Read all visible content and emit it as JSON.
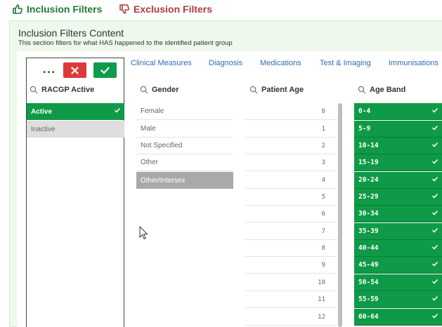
{
  "top_tabs": {
    "inclusion": "Inclusion Filters",
    "exclusion": "Exclusion Filters"
  },
  "content": {
    "title": "Inclusion Filters Content",
    "subtitle": "This section filters for what HAS happened to the identified patient group"
  },
  "nav_tabs": [
    "Clinical Measures",
    "Diagnosis",
    "Medications",
    "Test & Imaging",
    "Immunisations"
  ],
  "selection_toolbar": {
    "more": "...",
    "cancel_icon": "close-icon",
    "confirm_icon": "check-icon"
  },
  "columns": {
    "racgp": {
      "header": "RACGP Active",
      "items": [
        {
          "label": "Active",
          "state": "selected"
        },
        {
          "label": "Inactive",
          "state": "alternative"
        }
      ]
    },
    "gender": {
      "header": "Gender",
      "items": [
        {
          "label": "Female",
          "state": "possible"
        },
        {
          "label": "Male",
          "state": "possible"
        },
        {
          "label": "Not Specified",
          "state": "possible"
        },
        {
          "label": "Other",
          "state": "possible"
        },
        {
          "label": "Other/Intersex",
          "state": "excluded"
        }
      ]
    },
    "patient_age": {
      "header": "Patient Age",
      "items": [
        "0",
        "1",
        "2",
        "3",
        "4",
        "5",
        "6",
        "7",
        "8",
        "9",
        "10",
        "11",
        "12"
      ]
    },
    "age_band": {
      "header": "Age Band",
      "items": [
        "0-4",
        "5-9",
        "10-14",
        "15-19",
        "20-24",
        "25-29",
        "30-34",
        "35-39",
        "40-44",
        "45-49",
        "50-54",
        "55-59",
        "60-64"
      ]
    }
  },
  "colors": {
    "inclusion": "#1f7a35",
    "exclusion": "#b13a3a",
    "selected": "#0f9a47",
    "alternative": "#dedede",
    "excluded": "#a9a9a9",
    "link": "#2f6bb3",
    "content_bg": "#eef8ec",
    "cancel": "#dc3a3a",
    "confirm": "#0e9b4b"
  }
}
